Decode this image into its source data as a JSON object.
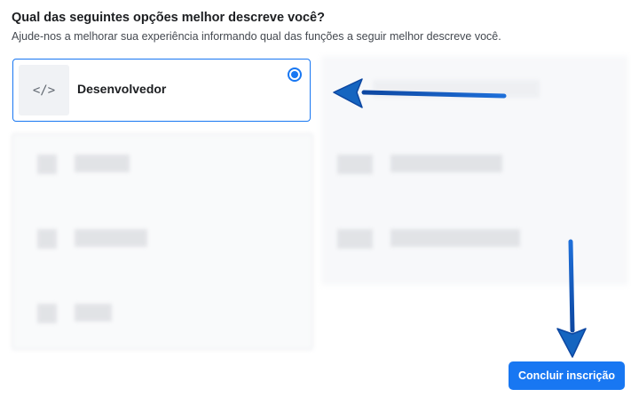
{
  "question": {
    "title": "Qual das seguintes opções melhor descreve você?",
    "subtitle": "Ajude-nos a melhorar sua experiência informando qual das funções a seguir melhor descreve você."
  },
  "options": {
    "selected": {
      "label": "Desenvolvedor",
      "icon": "code-icon",
      "icon_glyph": "</>"
    }
  },
  "submit": {
    "label": "Concluir inscrição"
  },
  "colors": {
    "accent": "#1877f2",
    "annotation_arrow": "#1565c0"
  }
}
